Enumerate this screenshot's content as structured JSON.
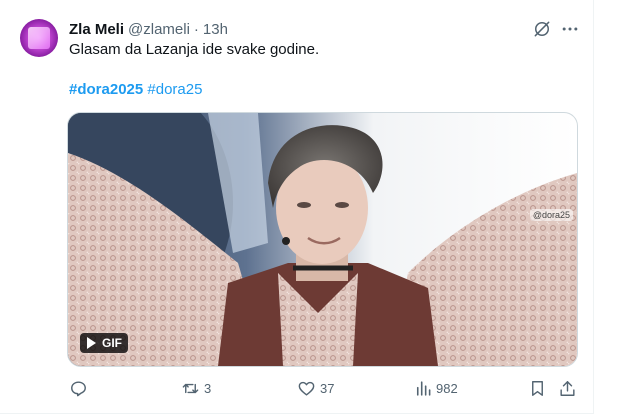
{
  "tweet": {
    "author_name": "Zla Meli",
    "handle": "@zlameli",
    "separator": "·",
    "time": "13h",
    "text": "Glasam da Lazanja ide svake godine.",
    "hashtags": [
      "#dora2025",
      "#dora25"
    ],
    "media": {
      "badge_label": "GIF",
      "watermark": "@dora25"
    },
    "actions": {
      "reply_count": "",
      "repost_count": "3",
      "like_count": "37",
      "views_count": "982"
    }
  },
  "colors": {
    "link": "#1d9bf0",
    "text_primary": "#0f1419",
    "text_secondary": "#536471",
    "border": "#cfd9de"
  },
  "icons": {
    "grok": "grok-icon",
    "more": "more-icon",
    "reply": "reply-icon",
    "repost": "repost-icon",
    "like": "heart-icon",
    "views": "views-icon",
    "bookmark": "bookmark-icon",
    "share": "share-icon",
    "gif_play": "play-icon"
  }
}
